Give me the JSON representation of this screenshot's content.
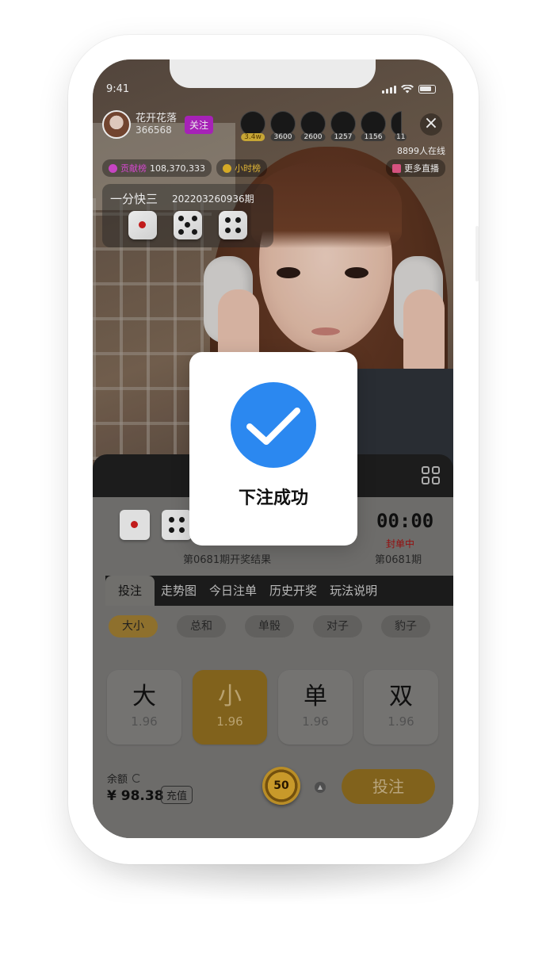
{
  "status_bar": {
    "time": "9:41"
  },
  "host": {
    "name": "花开花落",
    "id": "366568",
    "follow_label": "关注"
  },
  "viewers": [
    {
      "badge": "3.4w"
    },
    {
      "badge": "3600"
    },
    {
      "badge": "2600"
    },
    {
      "badge": "1257"
    },
    {
      "badge": "1156"
    },
    {
      "badge": "11"
    }
  ],
  "online_count": "8899人在线",
  "chips": {
    "contribution_label": "贡献榜",
    "contribution_value": "108,370,333",
    "hourly_label": "小时榜",
    "more_live": "更多直播"
  },
  "game_card": {
    "title": "一分快三",
    "period": "202203260936期"
  },
  "last_result": {
    "caption": "第0681期开奖结果"
  },
  "timer": {
    "countdown": "00:00",
    "status": "封单中",
    "period": "第0681期"
  },
  "tabs": [
    {
      "label": "投注"
    },
    {
      "label": "走势图"
    },
    {
      "label": "今日注单"
    },
    {
      "label": "历史开奖"
    },
    {
      "label": "玩法说明"
    }
  ],
  "subtabs": [
    {
      "label": "大小"
    },
    {
      "label": "总和"
    },
    {
      "label": "单骰"
    },
    {
      "label": "对子"
    },
    {
      "label": "豹子"
    }
  ],
  "bet_options": [
    {
      "name": "大",
      "odds": "1.96"
    },
    {
      "name": "小",
      "odds": "1.96"
    },
    {
      "name": "单",
      "odds": "1.96"
    },
    {
      "name": "双",
      "odds": "1.96"
    }
  ],
  "wallet": {
    "balance_label": "余额",
    "balance": "¥ 98.38",
    "recharge_label": "充值"
  },
  "chip_value": "50",
  "bet_button": "投注",
  "dialog": {
    "message": "下注成功"
  },
  "colors": {
    "accent_blue": "#2b88f0",
    "gold": "#8c6b1f",
    "follow_purple": "#b525c7",
    "sealed_red": "#a11010"
  }
}
